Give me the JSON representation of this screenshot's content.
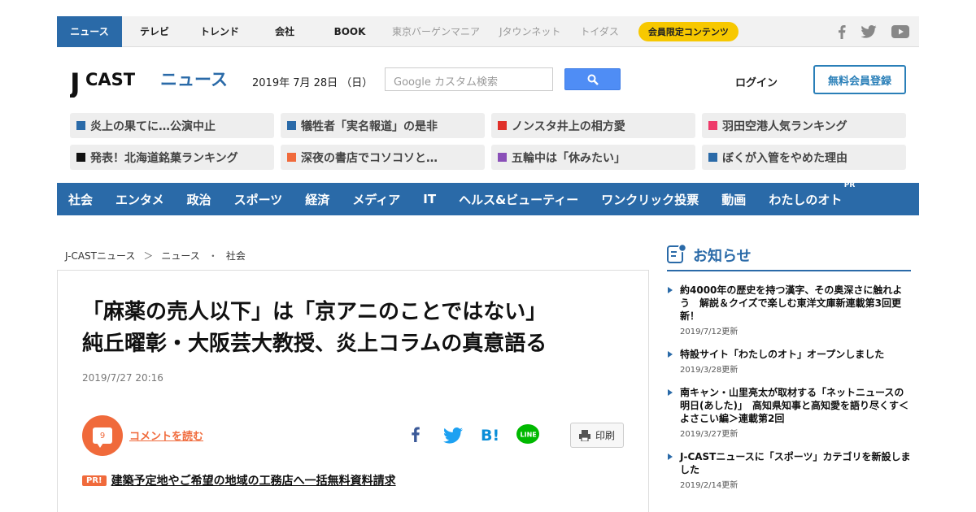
{
  "topnav": {
    "items": [
      "ニュース",
      "テレビ",
      "トレンド",
      "会社",
      "BOOK"
    ],
    "gray_items": [
      "東京バーゲンマニア",
      "Jタウンネット",
      "トイダス"
    ],
    "member_label": "会員限定コンテンツ"
  },
  "header": {
    "logo_j": "J",
    "logo_cast": "CAST",
    "logo_news": "ニュース",
    "date": "2019年 7月 28日 （日）",
    "search_placeholder": "Google カスタム検索",
    "login_label": "ログイン",
    "register_label": "無料会員登録"
  },
  "trending": [
    {
      "label": "炎上の果てに…公演中止",
      "color": "#2a6aa8"
    },
    {
      "label": "犠牲者「実名報道」の是非",
      "color": "#2a6aa8"
    },
    {
      "label": "ノンスタ井上の相方愛",
      "color": "#e0302a"
    },
    {
      "label": "羽田空港人気ランキング",
      "color": "#ee3a6a"
    },
    {
      "label": "発表！北海道銘菓ランキング",
      "color": "#111111"
    },
    {
      "label": "深夜の書店でコソコソと…",
      "color": "#f06a3b"
    },
    {
      "label": "五輪中は「休みたい」",
      "color": "#8a4fb8"
    },
    {
      "label": "ぼくが入管をやめた理由",
      "color": "#2a6aa8"
    }
  ],
  "categories": [
    "社会",
    "エンタメ",
    "政治",
    "スポーツ",
    "経済",
    "メディア",
    "IT",
    "ヘルス&ビューティー",
    "ワンクリック投票",
    "動画",
    "わたしのオト"
  ],
  "category_pr": "PR",
  "breadcrumb": [
    "J-CASTニュース",
    "＞",
    "ニュース",
    "・",
    "社会"
  ],
  "article": {
    "headline_1": "「麻薬の売人以下」は「京アニのことではない」",
    "headline_2": "純丘曜彰・大阪芸大教授、炎上コラムの真意語る",
    "date": "2019/7/27 20:16",
    "comment_count": "9",
    "comment_link": "コメントを読む",
    "print_label": "印刷",
    "pr_badge": "PR!",
    "pr_text": "建築予定地やご希望の地域の工務店へ一括無料資料請求"
  },
  "notice": {
    "title": "お知らせ",
    "items": [
      {
        "text": "約4000年の歴史を持つ漢字、その奥深さに触れよう　解説＆クイズで楽しむ東洋文庫新連載第3回更新！",
        "updated": "2019/7/12更新"
      },
      {
        "text": "特設サイト「わたしのオト」オープンしました",
        "updated": "2019/3/28更新"
      },
      {
        "text": "南キャン・山里亮太が取材する「ネットニュースの明日(あした)」　高知県知事と高知愛を語り尽くす＜よさこい編＞連載第2回",
        "updated": "2019/3/27更新"
      },
      {
        "text": "J-CASTニュースに「スポーツ」カテゴリを新設しました",
        "updated": "2019/2/14更新"
      }
    ]
  },
  "colors": {
    "brand_blue": "#2a6aa8",
    "accent_orange": "#f06a3b",
    "member_yellow": "#f7c800",
    "search_blue": "#4f8df5"
  }
}
